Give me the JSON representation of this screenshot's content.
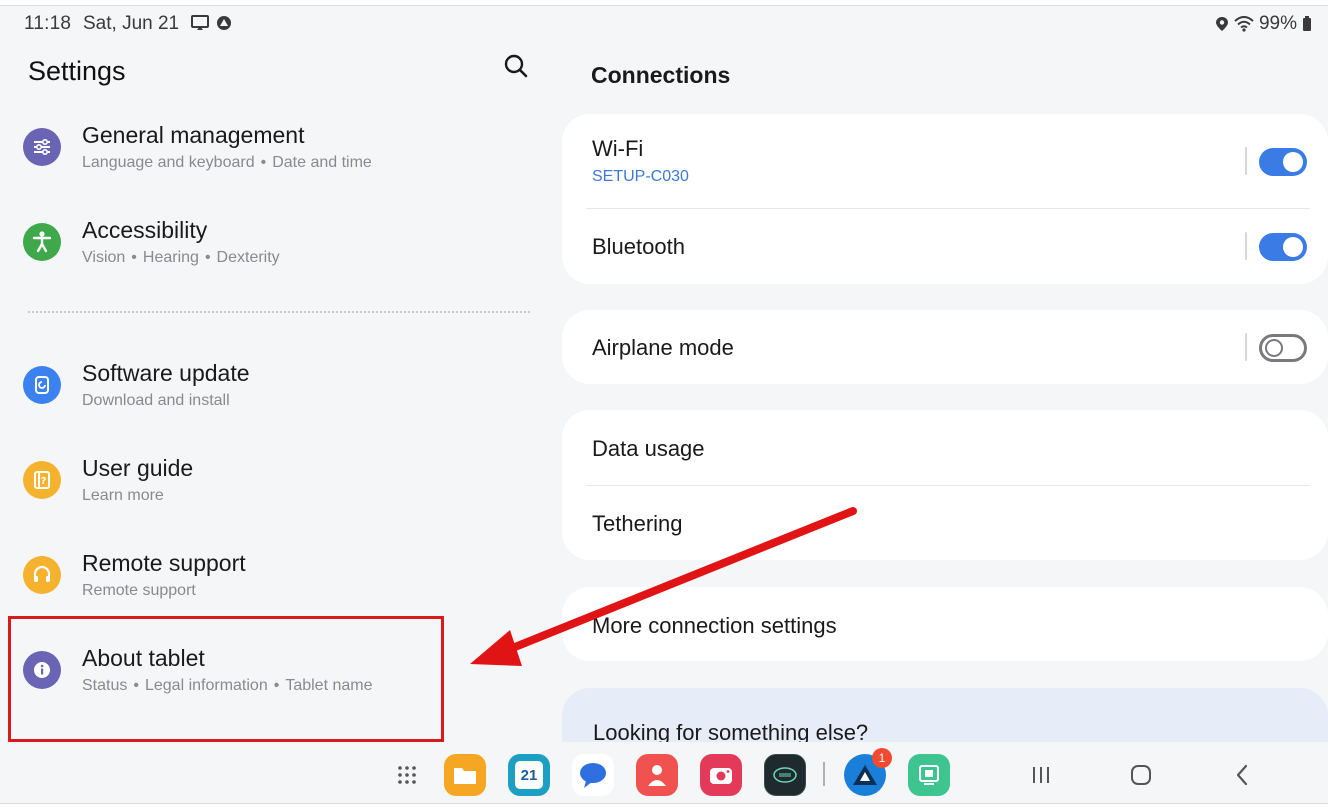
{
  "status": {
    "time": "11:18",
    "date": "Sat, Jun 21",
    "battery": "99%"
  },
  "left": {
    "title": "Settings",
    "items": [
      {
        "title": "General management",
        "subs": [
          "Language and keyboard",
          "Date and time"
        ],
        "icon": "sliders-icon",
        "color": "#6a64b4"
      },
      {
        "title": "Accessibility",
        "subs": [
          "Vision",
          "Hearing",
          "Dexterity"
        ],
        "icon": "accessibility-icon",
        "color": "#3fa84a"
      },
      {
        "title": "Software update",
        "subs": [
          "Download and install"
        ],
        "icon": "software-update-icon",
        "color": "#3b82f0"
      },
      {
        "title": "User guide",
        "subs": [
          "Learn more"
        ],
        "icon": "user-guide-icon",
        "color": "#f5b22e"
      },
      {
        "title": "Remote support",
        "subs": [
          "Remote support"
        ],
        "icon": "headset-icon",
        "color": "#f5b22e"
      },
      {
        "title": "About tablet",
        "subs": [
          "Status",
          "Legal information",
          "Tablet name"
        ],
        "icon": "info-icon",
        "color": "#6a64b4"
      }
    ]
  },
  "right": {
    "title": "Connections",
    "wifi": {
      "label": "Wi-Fi",
      "network": "SETUP-C030",
      "enabled": true
    },
    "bluetooth": {
      "label": "Bluetooth",
      "enabled": true
    },
    "airplane": {
      "label": "Airplane mode",
      "enabled": false
    },
    "data_usage": "Data usage",
    "tethering": "Tethering",
    "more": "More connection settings",
    "looking": "Looking for something else?"
  },
  "taskbar": {
    "calendar_day": "21",
    "badge_count": "1"
  },
  "colors": {
    "accent": "#3a7be6",
    "highlight": "#d91a1a"
  }
}
